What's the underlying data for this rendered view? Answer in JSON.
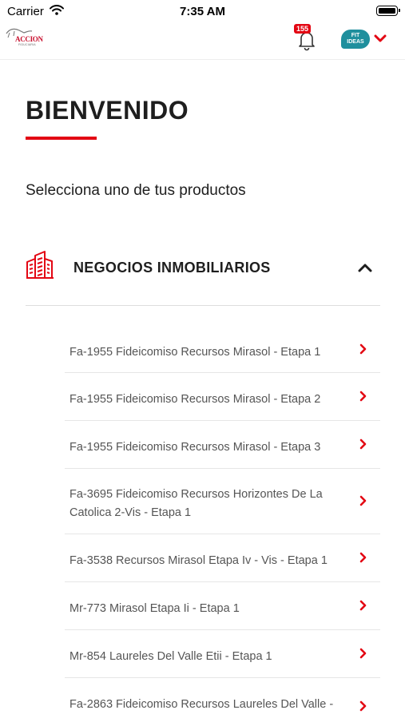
{
  "status_bar": {
    "carrier": "Carrier",
    "time": "7:35 AM"
  },
  "header": {
    "logo": {
      "word": "ACCION",
      "sub": "FIDUCIARIA"
    },
    "notifications_count": "155",
    "avatar": {
      "line1": "FIT",
      "line2": "IDEAS"
    }
  },
  "welcome": {
    "title": "BIENVENIDO",
    "subtitle": "Selecciona uno de tus productos"
  },
  "section": {
    "title": "NEGOCIOS INMOBILIARIOS",
    "items": [
      {
        "label": "Fa-1955 Fideicomiso Recursos Mirasol - Etapa 1"
      },
      {
        "label": "Fa-1955 Fideicomiso Recursos Mirasol - Etapa 2"
      },
      {
        "label": "Fa-1955 Fideicomiso Recursos Mirasol - Etapa 3"
      },
      {
        "label": "Fa-3695 Fideicomiso Recursos Horizontes De La Catolica 2-Vis - Etapa 1"
      },
      {
        "label": "Fa-3538 Recursos Mirasol Etapa Iv - Vis - Etapa 1"
      },
      {
        "label": "Mr-773 Mirasol Etapa Ii - Etapa 1"
      },
      {
        "label": "Mr-854 Laureles Del Valle Etii - Etapa 1"
      },
      {
        "label": "Fa-2863 Fideicomiso Recursos Laureles Del Valle -"
      }
    ]
  },
  "colors": {
    "accent": "#e30613",
    "avatar": "#1f8f9d",
    "text": "#1e1e1e",
    "muted": "#555555"
  },
  "icons": {
    "wifi": "wifi-icon",
    "battery": "battery-icon",
    "bell": "bell-icon",
    "avatar_chevron": "chevron-down-icon",
    "section": "buildings-icon",
    "section_chevron": "chevron-up-icon",
    "item_chevron": "chevron-right-icon"
  }
}
